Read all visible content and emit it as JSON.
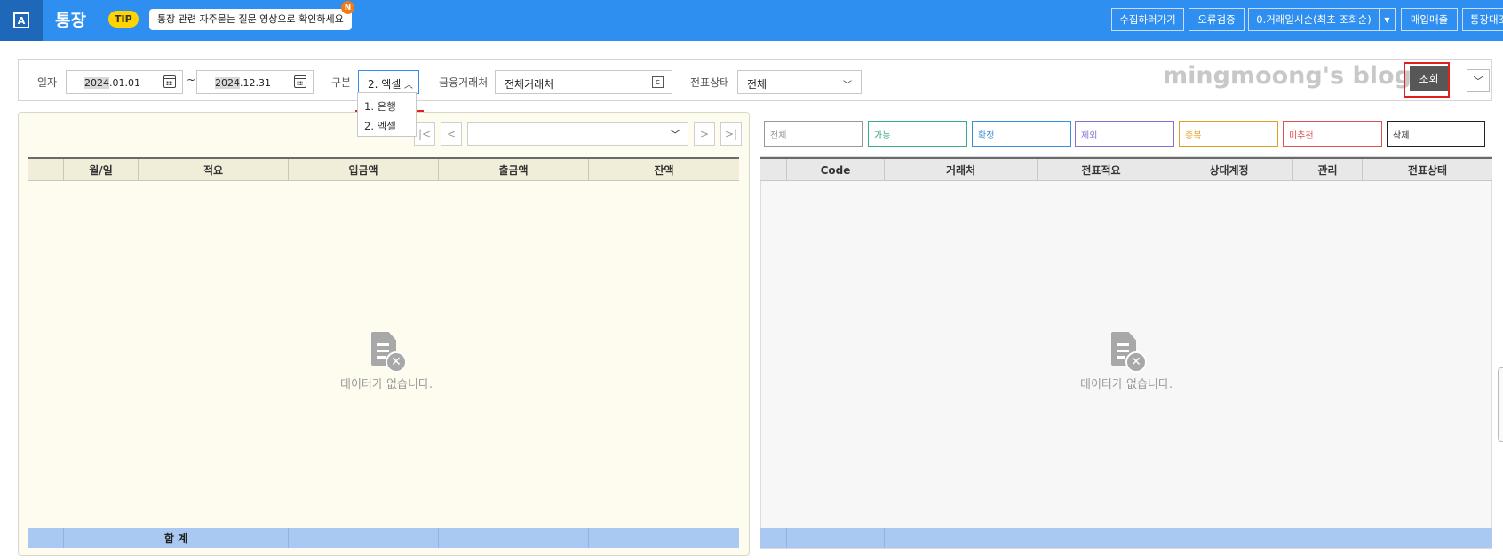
{
  "header": {
    "app_icon": "A",
    "title": "통장",
    "tip_label": "TIP",
    "tip_text": "통장 관련 자주묻는 질문 영상으로 확인하세요",
    "tip_new": "N",
    "buttons": [
      "수집하러가기",
      "오류검증",
      "0.거래일시순(최초 조회순)",
      "매입매출",
      "통장대조"
    ]
  },
  "filter": {
    "date_label": "일자",
    "date_from_year": "2024",
    "date_from_rest": ".01.01",
    "date_to_year": "2024",
    "date_to_rest": ".12.31",
    "tilde": "~",
    "gubun_label": "구분",
    "gubun_value": "2. 엑셀",
    "gubun_options": [
      "1.  은행",
      "2.  엑셀"
    ],
    "partner_label": "금융거래처",
    "partner_value": "전체거래처",
    "status_label": "전표상태",
    "status_value": "전체",
    "watermark": "mingmoong's blog",
    "search_label": "조회"
  },
  "left_grid": {
    "columns": [
      "월/일",
      "적요",
      "입금액",
      "출금액",
      "잔액"
    ],
    "footer_label": "합    계",
    "empty_text": "데이터가 없습니다."
  },
  "right_filters": [
    "전체",
    "가능",
    "확정",
    "제외",
    "중복",
    "미추천",
    "삭제"
  ],
  "right_filter_colors": [
    "#999999",
    "#3aa98a",
    "#3b8fd9",
    "#8a6fd0",
    "#e0a020",
    "#e05050",
    "#222222"
  ],
  "right_grid": {
    "columns": [
      "Code",
      "거래처",
      "전표적요",
      "상대계정",
      "관리",
      "전표상태"
    ],
    "empty_text": "데이터가 없습니다."
  },
  "icons": {
    "calendar": "calendar-icon",
    "chevron": "chevron-down-icon",
    "empty": "no-data-icon"
  }
}
